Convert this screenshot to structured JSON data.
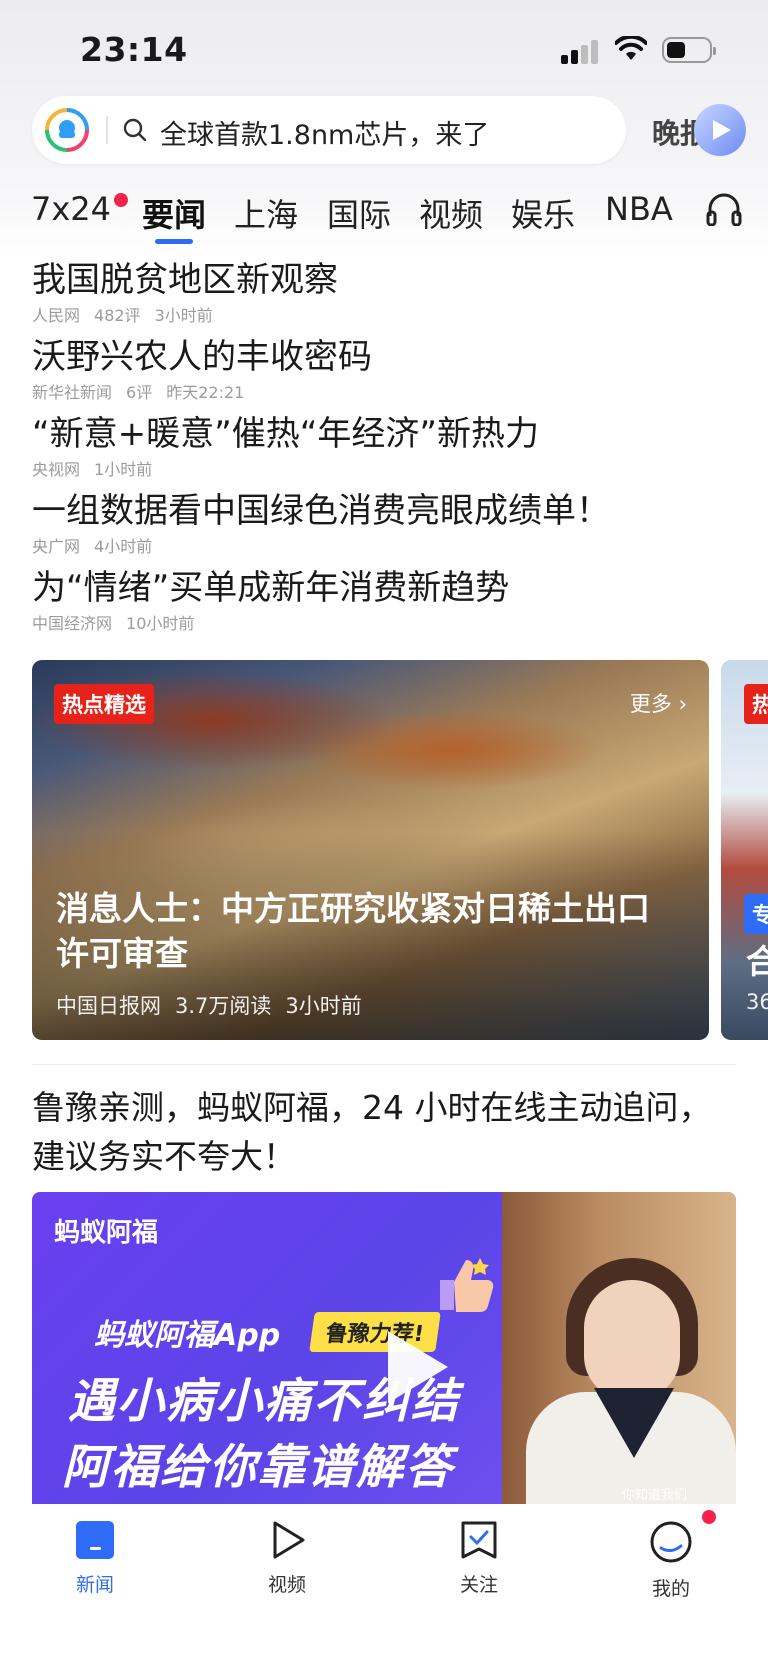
{
  "status_bar": {
    "time": "23:14"
  },
  "search": {
    "placeholder": "全球首款1.8nm芯片，来了",
    "evening_label": "晚报"
  },
  "tabs": [
    {
      "label": "7x24",
      "active": false,
      "has_dot": true
    },
    {
      "label": "要闻",
      "active": true
    },
    {
      "label": "上海",
      "active": false
    },
    {
      "label": "国际",
      "active": false
    },
    {
      "label": "视频",
      "active": false
    },
    {
      "label": "娱乐",
      "active": false
    },
    {
      "label": "NBA",
      "active": false
    }
  ],
  "headlines": [
    {
      "title": "我国脱贫地区新观察",
      "source": "人民网",
      "comments": "482评",
      "time": "3小时前"
    },
    {
      "title": "沃野兴农人的丰收密码",
      "source": "新华社新闻",
      "comments": "6评",
      "time": "昨天22:21"
    },
    {
      "title": "“新意+暖意”催热“年经济”新热力",
      "source": "央视网",
      "comments": "",
      "time": "1小时前"
    },
    {
      "title": "一组数据看中国绿色消费亮眼成绩单！",
      "source": "央广网",
      "comments": "",
      "time": "4小时前"
    },
    {
      "title": "为“情绪”买单成新年消费新趋势",
      "source": "中国经济网",
      "comments": "",
      "time": "10小时前"
    }
  ],
  "hot_card": {
    "badge": "热点精选",
    "more": "更多",
    "title": "消息人士：中方正研究收紧对日稀土出口许可审查",
    "source": "中国日报网",
    "reads": "3.7万阅读",
    "time": "3小时前"
  },
  "hot_card_peek": {
    "badge": "热",
    "badge2": "专",
    "title": "合",
    "meta": "36"
  },
  "ad": {
    "title": "鲁豫亲测，蚂蚁阿福，24 小时在线主动追问，建议务实不夸大！",
    "logo": "蚂蚁阿福",
    "app": "蚂蚁阿福App",
    "tag": "鲁豫力荐!",
    "line1": "遇小病小痛不纠结",
    "line2": "阿福给你靠谱解答",
    "caption": "你知道我们"
  },
  "bottom_nav": [
    {
      "label": "新闻",
      "active": true,
      "icon": "news-icon"
    },
    {
      "label": "视频",
      "active": false,
      "icon": "video-icon"
    },
    {
      "label": "关注",
      "active": false,
      "icon": "follow-icon"
    },
    {
      "label": "我的",
      "active": false,
      "icon": "profile-icon",
      "has_dot": true
    }
  ],
  "colors": {
    "accent": "#2f6cf6",
    "hot_badge": "#e5231b",
    "dot": "#f5224b"
  }
}
